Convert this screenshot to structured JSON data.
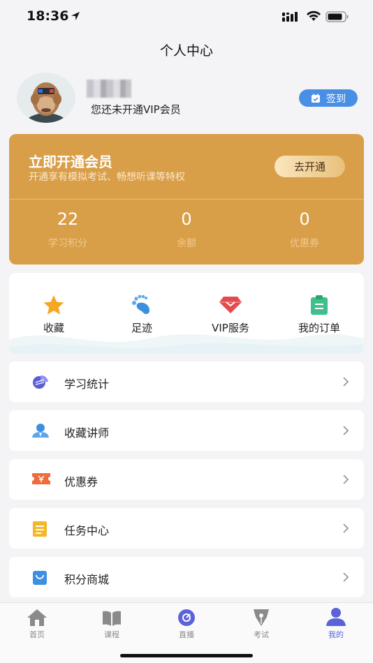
{
  "status_bar": {
    "time": "18:36"
  },
  "header": {
    "title": "个人中心"
  },
  "profile": {
    "member_status": "您还未开通VIP会员",
    "checkin_label": "签到"
  },
  "vip_card": {
    "title": "立即开通会员",
    "subtitle": "开通享有模拟考试、畅想听课等特权",
    "open_label": "去开通",
    "stats": [
      {
        "value": "22",
        "label": "学习积分"
      },
      {
        "value": "0",
        "label": "余额"
      },
      {
        "value": "0",
        "label": "优惠券"
      }
    ]
  },
  "quick_actions": [
    {
      "label": "收藏",
      "icon": "star-icon"
    },
    {
      "label": "足迹",
      "icon": "footprint-icon"
    },
    {
      "label": "VIP服务",
      "icon": "diamond-icon"
    },
    {
      "label": "我的订单",
      "icon": "clipboard-icon"
    }
  ],
  "menu": [
    {
      "label": "学习统计",
      "icon": "pie-chart-icon"
    },
    {
      "label": "收藏讲师",
      "icon": "teacher-icon"
    },
    {
      "label": "优惠券",
      "icon": "coupon-icon"
    },
    {
      "label": "任务中心",
      "icon": "task-icon"
    },
    {
      "label": "积分商城",
      "icon": "shopping-bag-icon"
    }
  ],
  "tab_bar": [
    {
      "label": "首页",
      "icon": "home-icon"
    },
    {
      "label": "课程",
      "icon": "book-icon"
    },
    {
      "label": "直播",
      "icon": "live-icon"
    },
    {
      "label": "考试",
      "icon": "pen-icon"
    },
    {
      "label": "我的",
      "icon": "user-icon",
      "active": true
    }
  ],
  "colors": {
    "accent": "#5b63d8",
    "vip": "#d99e48",
    "checkin": "#4a8fe6"
  }
}
